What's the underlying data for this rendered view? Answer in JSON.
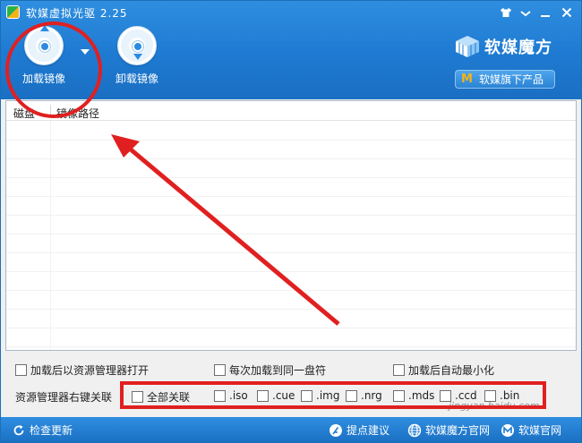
{
  "window": {
    "title": "软媒虚拟光驱 2.25"
  },
  "toolbar": {
    "load_label": "加载镜像",
    "unload_label": "卸载镜像"
  },
  "brand": {
    "name": "软媒魔方",
    "products_label": "软媒旗下产品",
    "m_letter": "M"
  },
  "list": {
    "columns": [
      "磁盘",
      "镜像路径"
    ],
    "rows": []
  },
  "options": {
    "open_explorer": "加载后以资源管理器打开",
    "same_drive": "每次加载到同一盘符",
    "auto_minimize": "加载后自动最小化"
  },
  "association": {
    "label": "资源管理器右键关联",
    "all": "全部关联",
    "types": [
      ".iso",
      ".cue",
      ".img",
      ".nrg",
      ".mds",
      ".ccd",
      ".bin"
    ]
  },
  "statusbar": {
    "update": "检查更新",
    "feedback": "提点建议",
    "rubik_site": "软媒魔方官网",
    "official_site": "软媒官网"
  },
  "watermark": "jingyan.baidu.com",
  "colors": {
    "accent": "#1e7ad1",
    "annotation": "#e02020"
  }
}
